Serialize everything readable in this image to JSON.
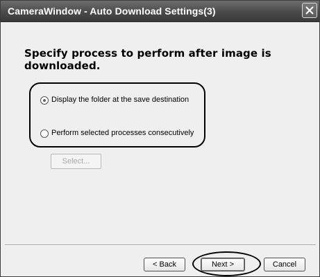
{
  "window": {
    "title": "CameraWindow - Auto Download Settings(3)"
  },
  "content": {
    "heading": "Specify process to perform after image is downloaded.",
    "options": [
      {
        "label": "Display the folder at the save destination",
        "selected": true
      },
      {
        "label": "Perform selected processes consecutively",
        "selected": false
      }
    ],
    "select_button_label": "Select...",
    "select_button_enabled": false
  },
  "footer": {
    "back_label": "< Back",
    "next_label": "Next >",
    "cancel_label": "Cancel"
  },
  "icons": {
    "close": "close-icon"
  }
}
